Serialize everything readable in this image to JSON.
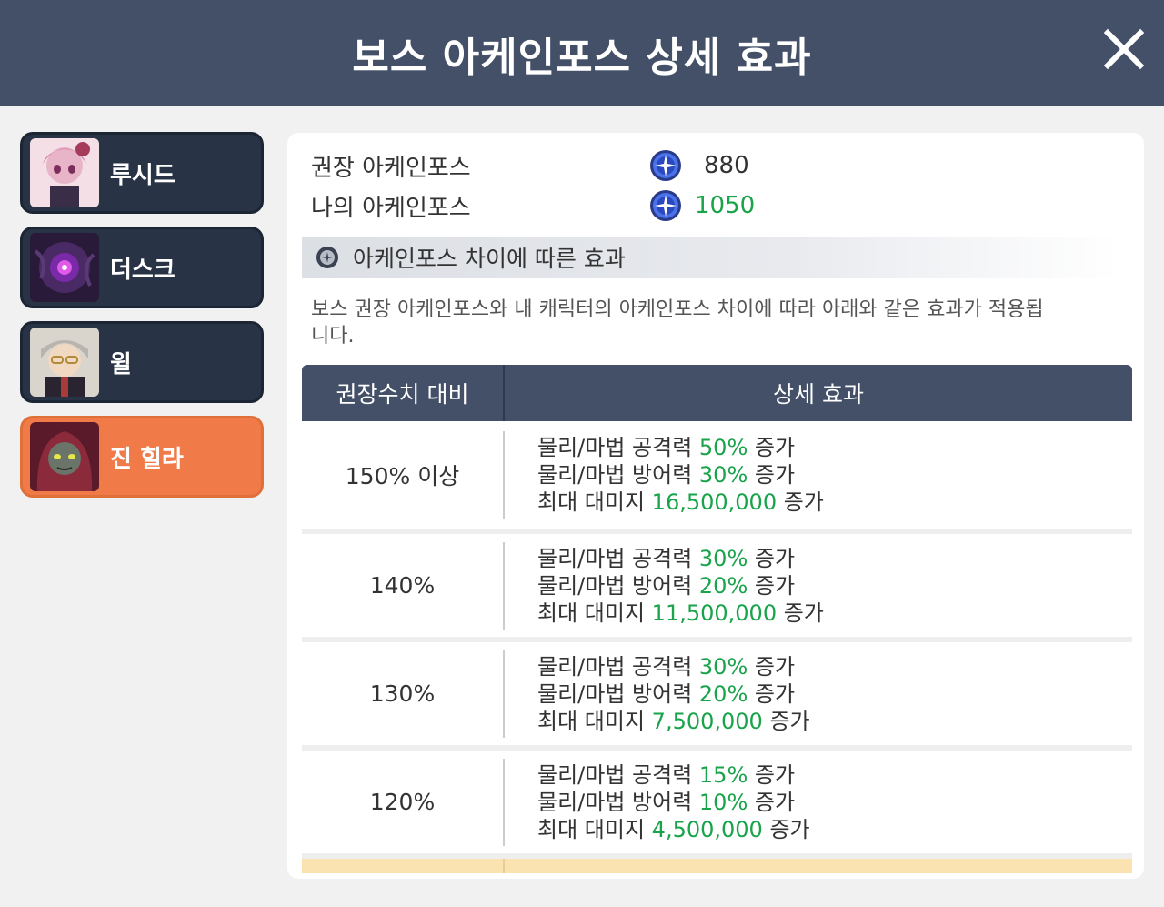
{
  "window": {
    "title": "보스 아케인포스 상세 효과"
  },
  "sidebar": {
    "items": [
      {
        "name": "루시드",
        "active": false
      },
      {
        "name": "더스크",
        "active": false
      },
      {
        "name": "윌",
        "active": false
      },
      {
        "name": "진 힐라",
        "active": true
      }
    ]
  },
  "force": {
    "recommended_label": "권장 아케인포스",
    "recommended_value": "880",
    "mine_label": "나의 아케인포스",
    "mine_value": "1050"
  },
  "section": {
    "title": "아케인포스 차이에 따른 효과",
    "description": "보스 권장 아케인포스와 내 캐릭터의 아케인포스 차이에 따라 아래와 같은 효과가 적용됩니다."
  },
  "table": {
    "headers": [
      "권장수치 대비",
      "상세 효과"
    ],
    "rows": [
      {
        "ratio": "150% 이상",
        "lines": [
          {
            "pre": "물리/마법 공격력 ",
            "val": "50%",
            "post": " 증가"
          },
          {
            "pre": "물리/마법 방어력 ",
            "val": "30%",
            "post": " 증가"
          },
          {
            "pre": "최대 대미지 ",
            "val": "16,500,000",
            "post": " 증가"
          }
        ]
      },
      {
        "ratio": "140%",
        "lines": [
          {
            "pre": "물리/마법 공격력 ",
            "val": "30%",
            "post": " 증가"
          },
          {
            "pre": "물리/마법 방어력 ",
            "val": "20%",
            "post": " 증가"
          },
          {
            "pre": "최대 대미지 ",
            "val": "11,500,000",
            "post": " 증가"
          }
        ]
      },
      {
        "ratio": "130%",
        "lines": [
          {
            "pre": "물리/마법 공격력 ",
            "val": "30%",
            "post": " 증가"
          },
          {
            "pre": "물리/마법 방어력 ",
            "val": "20%",
            "post": " 증가"
          },
          {
            "pre": "최대 대미지 ",
            "val": "7,500,000",
            "post": " 증가"
          }
        ]
      },
      {
        "ratio": "120%",
        "lines": [
          {
            "pre": "물리/마법 공격력 ",
            "val": "15%",
            "post": " 증가"
          },
          {
            "pre": "물리/마법 방어력 ",
            "val": "10%",
            "post": " 증가"
          },
          {
            "pre": "최대 대미지 ",
            "val": "4,500,000",
            "post": " 증가"
          }
        ]
      }
    ]
  },
  "colors": {
    "titlebar": "#435068",
    "sidebar_item": "#283446",
    "sidebar_active": "#f07a48",
    "highlight_value": "#19a34a"
  },
  "icons": {
    "close": "close-x-icon",
    "arcane": "arcane-force-icon",
    "section": "section-dot-icon"
  }
}
